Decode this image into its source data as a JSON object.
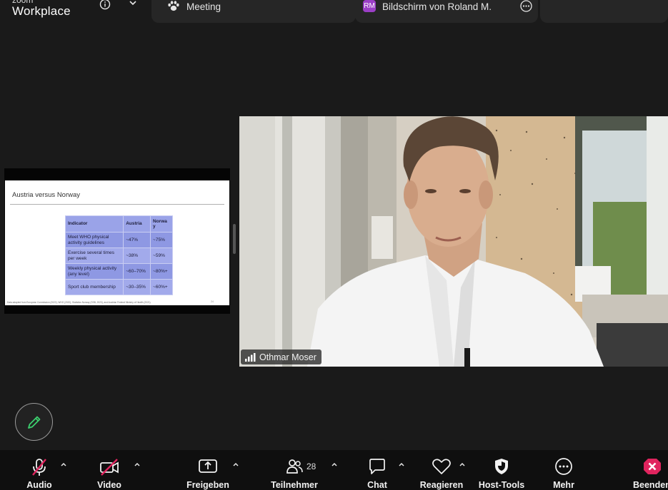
{
  "app": {
    "brand_top": "zoom",
    "brand_name": "Workplace"
  },
  "tabs": {
    "meeting": {
      "label": "Meeting",
      "icon": "paw-icon"
    },
    "screen": {
      "badge": "RM",
      "label": "Bildschirm von Roland M.",
      "badge_color": "#9b3fc6"
    }
  },
  "slide": {
    "title": "Austria versus Norway",
    "headers": [
      "Indicator",
      "Austria",
      "Norwa y"
    ],
    "rows": [
      [
        "Meet WHO physical activity guidelines",
        "~47%",
        "~75%"
      ],
      [
        "Exercise several times per week",
        "~38%",
        "~59%"
      ],
      [
        "Weekly physical activity (any level)",
        "~60–70%",
        "~80%+"
      ],
      [
        "Sport club membership",
        "~30–35%",
        "~60%+"
      ]
    ],
    "footnote": "Data adapted from European Commission (2022), WHO (2020), Statistics Norway (SSB, 2023), and Austrian Federal Ministry of Health (2021).",
    "page_number": "24"
  },
  "video": {
    "participant_name": "Othmar Moser"
  },
  "toolbar": {
    "audio": "Audio",
    "video": "Video",
    "share": "Freigeben",
    "participants": "Teilnehmer",
    "participants_count": "28",
    "chat": "Chat",
    "react": "Reagieren",
    "host_tools": "Host-Tools",
    "more": "Mehr",
    "end": "Beenden",
    "end_color": "#e0245e",
    "muted_color": "#e0245e"
  }
}
